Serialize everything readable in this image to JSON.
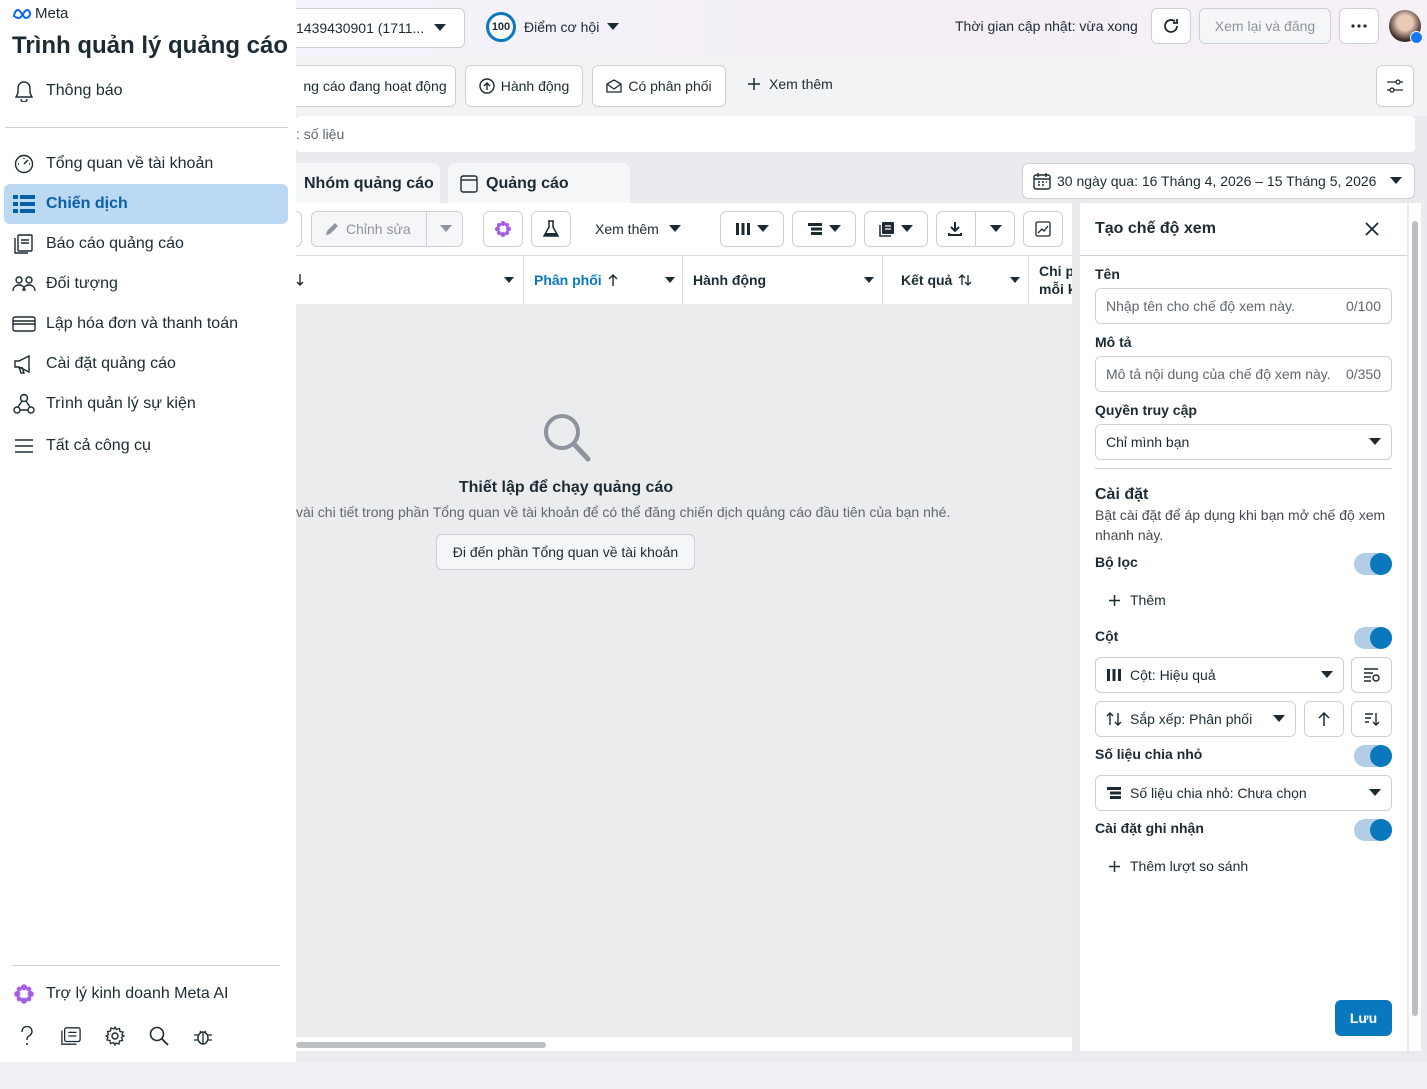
{
  "sidebar": {
    "brand": "Meta",
    "app_title": "Trình quản lý quảng cáo",
    "notifications": "Thông báo",
    "items": [
      {
        "label": "Tổng quan về tài khoản",
        "icon": "gauge-icon"
      },
      {
        "label": "Chiến dịch",
        "icon": "table-icon",
        "active": true
      },
      {
        "label": "Báo cáo quảng cáo",
        "icon": "report-icon"
      },
      {
        "label": "Đối tượng",
        "icon": "people-icon"
      },
      {
        "label": "Lập hóa đơn và thanh toán",
        "icon": "card-icon"
      },
      {
        "label": "Cài đặt quảng cáo",
        "icon": "megaphone-icon"
      },
      {
        "label": "Trình quản lý sự kiện",
        "icon": "events-icon"
      },
      {
        "label": "Tất cả công cụ",
        "icon": "menu-icon"
      }
    ],
    "assistant": "Trợ lý kinh doanh Meta AI"
  },
  "topbar": {
    "account": "1439430901 (1711...",
    "score": "100",
    "score_label": "Điểm cơ hội",
    "updated": "Thời gian cập nhật: vừa xong",
    "review_publish": "Xem lại và đăng"
  },
  "filters": {
    "active_ads": "ng cáo đang hoạt động",
    "actions": "Hành động",
    "delivery": "Có phân phối",
    "more": "Xem thêm"
  },
  "search": {
    "placeholder": ": số liệu"
  },
  "tabs": {
    "adsets": "Nhóm quảng cáo",
    "ads": "Quảng cáo"
  },
  "date_range": "30 ngày qua: 16 Tháng 4, 2026 – 15 Tháng 5, 2026",
  "toolbar": {
    "edit": "Chỉnh sửa",
    "more": "Xem thêm"
  },
  "columns": [
    "Phân phối",
    "Hành động",
    "Kết quả",
    "Chi p",
    "mỗi k"
  ],
  "empty_state": {
    "title": "Thiết lập để chạy quảng cáo",
    "desc": "vài chi tiết trong phần Tổng quan về tài khoản để có thể đăng chiến dịch quảng cáo đầu tiên của bạn nhé.",
    "button": "Đi đến phần Tổng quan về tài khoản"
  },
  "panel": {
    "title": "Tạo chế độ xem",
    "name_label": "Tên",
    "name_placeholder": "Nhập tên cho chế độ xem này.",
    "name_count": "0/100",
    "desc_label": "Mô tả",
    "desc_placeholder": "Mô tả nội dung của chế độ xem này.",
    "desc_count": "0/350",
    "access_label": "Quyền truy cập",
    "access_value": "Chỉ mình bạn",
    "settings_label": "Cài đặt",
    "settings_desc_1": "Bật cài đặt để áp dụng khi bạn mở chế độ xem",
    "settings_desc_2": "nhanh này.",
    "filter_label": "Bộ lọc",
    "filter_add": "Thêm",
    "columns_label": "Cột",
    "columns_value": "Cột: Hiệu quả",
    "sort_value": "Sắp xếp: Phân phối",
    "breakdown_label": "Số liệu chia nhỏ",
    "breakdown_value": "Số liệu chia nhỏ: Chưa chọn",
    "attribution_label": "Cài đặt ghi nhận",
    "add_comparison": "Thêm lượt so sánh",
    "save": "Lưu"
  },
  "colors": {
    "accent": "#0a78be",
    "active_bg": "#bcd9f3"
  }
}
